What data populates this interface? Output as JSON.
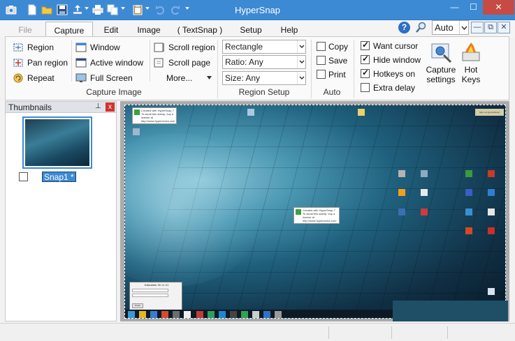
{
  "app": {
    "title": "HyperSnap"
  },
  "window_controls": {
    "minimize": "—",
    "maximize": "☐",
    "close": "✕"
  },
  "quick_access": [
    "camera-icon",
    "new-icon",
    "open-icon",
    "save-icon",
    "share-icon",
    "print-icon",
    "copy-icon",
    "paste-icon",
    "undo-icon",
    "redo-icon"
  ],
  "tabs": [
    {
      "label": "File",
      "state": "disabled"
    },
    {
      "label": "Capture",
      "state": "active"
    },
    {
      "label": "Edit"
    },
    {
      "label": "Image"
    },
    {
      "label": "( TextSnap )"
    },
    {
      "label": "Setup"
    },
    {
      "label": "Help"
    }
  ],
  "toolbar_right": {
    "help_glyph": "?",
    "zoom_value": "Auto",
    "mdi_minimize": "—",
    "mdi_restore": "⧉",
    "mdi_close": "✕"
  },
  "capture_image": {
    "group_label": "Capture Image",
    "col1": [
      "Region",
      "Pan region",
      "Repeat"
    ],
    "col2": [
      "Window",
      "Active window",
      "Full Screen"
    ],
    "col3": [
      "Scroll region",
      "Scroll page",
      "More..."
    ]
  },
  "region_setup": {
    "group_label": "Region Setup",
    "shape": "Rectangle",
    "ratio": "Ratio: Any",
    "size": "Size: Any"
  },
  "auto": {
    "group_label": "Auto",
    "options": [
      {
        "label": "Copy",
        "checked": false
      },
      {
        "label": "Save",
        "checked": false
      },
      {
        "label": "Print",
        "checked": false
      }
    ]
  },
  "capture_options": [
    {
      "label": "Want cursor",
      "checked": true
    },
    {
      "label": "Hide window",
      "checked": true
    },
    {
      "label": "Hotkeys on",
      "checked": true
    },
    {
      "label": "Extra delay",
      "checked": false
    }
  ],
  "big_buttons": {
    "capture_settings_line1": "Capture",
    "capture_settings_line2": "settings",
    "hot_keys_line1": "Hot",
    "hot_keys_line2": "Keys"
  },
  "thumbnails": {
    "title": "Thumbnails",
    "pin_glyph": "⊥",
    "close_glyph": "x",
    "items": [
      {
        "label": "Snap1 *",
        "checked": false
      }
    ]
  },
  "snapshot": {
    "watermark_lines": [
      "Created with HyperSnap 7",
      "To avoid this stamp, buy a license at",
      "http://www.hyperionics.com"
    ],
    "corner_note": "Sign out (generalnow)",
    "calc_title": "Kalkulator XII v1.01",
    "calc_button": "Prefer"
  },
  "colors": {
    "titlebar": "#3d8ad4",
    "accent": "#3d8ad4",
    "close_button": "#c74b45"
  }
}
